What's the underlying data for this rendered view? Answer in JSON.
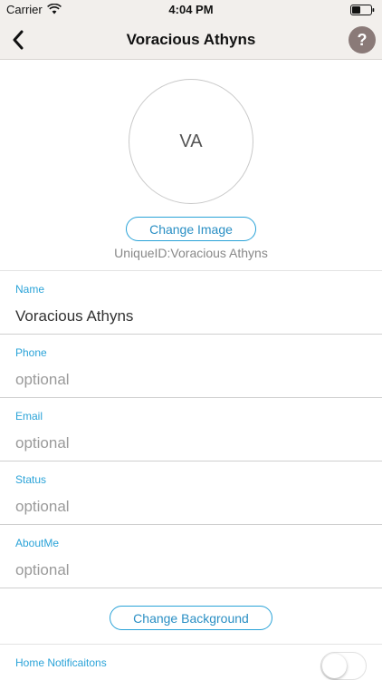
{
  "status_bar": {
    "carrier": "Carrier",
    "time": "4:04 PM"
  },
  "nav": {
    "title": "Voracious Athyns",
    "help_label": "?"
  },
  "profile": {
    "avatar_initials": "VA",
    "change_image_label": "Change Image",
    "unique_id": "UniqueID:Voracious Athyns"
  },
  "fields": [
    {
      "label": "Name",
      "value": "Voracious Athyns",
      "placeholder": ""
    },
    {
      "label": "Phone",
      "value": "",
      "placeholder": "optional"
    },
    {
      "label": "Email",
      "value": "",
      "placeholder": "optional"
    },
    {
      "label": "Status",
      "value": "",
      "placeholder": "optional"
    },
    {
      "label": "AboutMe",
      "value": "",
      "placeholder": "optional"
    }
  ],
  "change_background_label": "Change Background",
  "home_notifications": {
    "label": "Home Notificaitons",
    "on": false
  },
  "colors": {
    "accent": "#2aa3d8",
    "nav_bg": "#f2efec",
    "help_bg": "#8a7a78"
  }
}
